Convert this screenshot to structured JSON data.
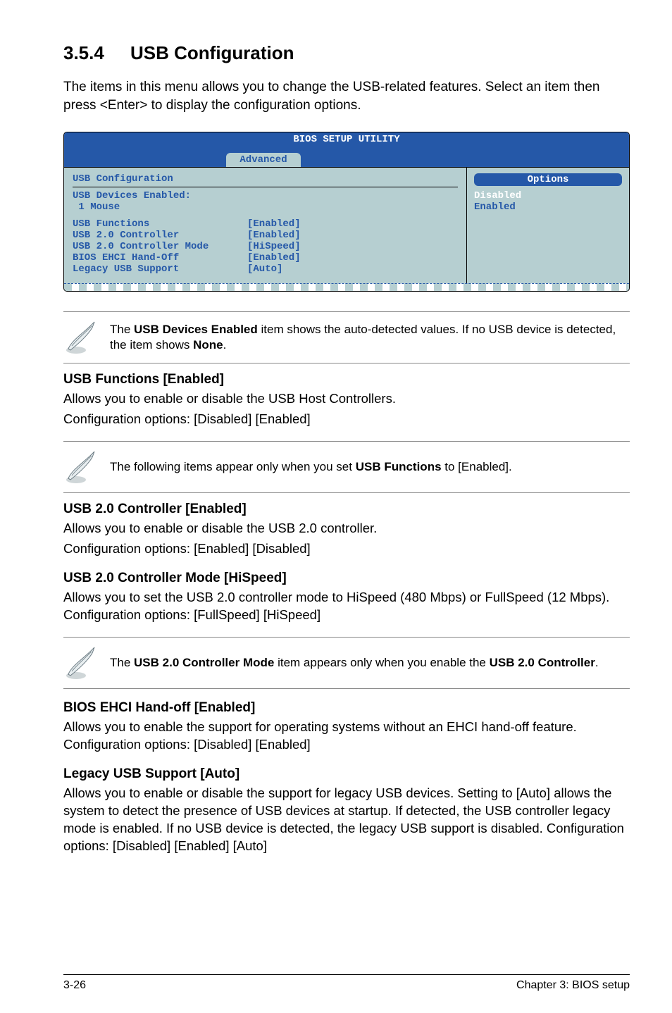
{
  "section": {
    "number": "3.5.4",
    "title": "USB Configuration",
    "intro": "The items in this menu allows you to change the USB-related features. Select an item then press <Enter> to display the configuration options."
  },
  "bios": {
    "title": "BIOS SETUP UTILITY",
    "tab": "Advanced",
    "panel_title": "USB Configuration",
    "devices_label": "USB Devices Enabled:",
    "devices_line": " 1 Mouse",
    "rows": [
      {
        "key": "USB Functions",
        "val": "[Enabled]"
      },
      {
        "key": "USB 2.0 Controller",
        "val": "[Enabled]"
      },
      {
        "key": "USB 2.0 Controller Mode",
        "val": "[HiSpeed]"
      },
      {
        "key": "BIOS EHCI Hand-Off",
        "val": "[Enabled]"
      },
      {
        "key": "Legacy USB Support",
        "val": "[Auto]"
      }
    ],
    "options_title": "Options",
    "opt_disabled": "Disabled",
    "opt_enabled": "Enabled"
  },
  "notes": {
    "n1a": "The ",
    "n1b": "USB Devices Enabled",
    "n1c": " item shows the auto-detected values. If no USB device is detected, the item shows ",
    "n1d": "None",
    "n1e": ".",
    "n2a": "The following items appear only when you set ",
    "n2b": "USB Functions",
    "n2c": " to [Enabled].",
    "n3a": "The ",
    "n3b": "USB 2.0 Controller Mode",
    "n3c": " item appears only when you enable the ",
    "n3d": "USB 2.0 Controller",
    "n3e": "."
  },
  "sub": {
    "s1_title": "USB Functions [Enabled]",
    "s1_p1": "Allows you to enable or disable the USB Host Controllers.",
    "s1_p2": "Configuration options: [Disabled] [Enabled]",
    "s2_title": "USB 2.0 Controller [Enabled]",
    "s2_p1": "Allows you to enable or disable the USB 2.0 controller.",
    "s2_p2": "Configuration options: [Enabled] [Disabled]",
    "s3_title": "USB 2.0 Controller Mode [HiSpeed]",
    "s3_p": "Allows you to set the USB 2.0 controller mode to HiSpeed (480 Mbps) or FullSpeed (12 Mbps). Configuration options: [FullSpeed] [HiSpeed]",
    "s4_title": "BIOS EHCI Hand-off [Enabled]",
    "s4_p": "Allows you to enable the support for operating systems without an EHCI hand-off feature. Configuration options: [Disabled] [Enabled]",
    "s5_title": "Legacy USB Support [Auto]",
    "s5_p": "Allows you to enable or disable the support for legacy USB devices. Setting to [Auto] allows the system to detect the presence of USB devices at startup. If detected, the USB controller legacy mode is enabled. If no USB device is detected, the legacy USB support is disabled. Configuration options: [Disabled] [Enabled] [Auto]"
  },
  "footer": {
    "left": "3-26",
    "right": "Chapter 3: BIOS setup"
  }
}
